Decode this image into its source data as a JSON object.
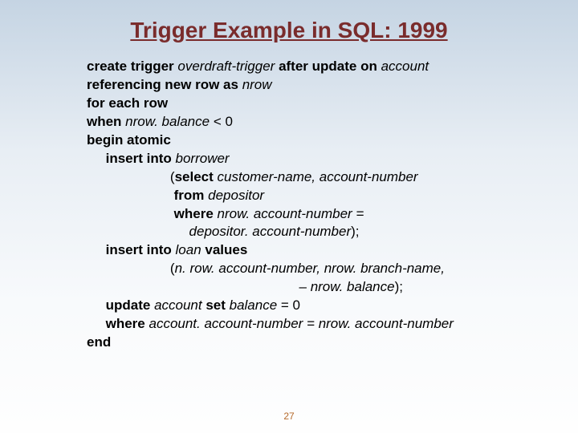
{
  "title": "Trigger Example in SQL: 1999",
  "page_number": "27",
  "code": {
    "l1a": "create trigger ",
    "l1b": "overdraft-trigger ",
    "l1c": "after update on ",
    "l1d": "account",
    "l2a": "referencing new row as ",
    "l2b": "nrow",
    "l3a": "for each row",
    "l4a": "when ",
    "l4b": "nrow. balance ",
    "l4c": "< 0",
    "l5a": "begin atomic",
    "l6a": "     insert into ",
    "l6b": "borrower",
    "l7a": "                      (",
    "l7b": "select ",
    "l7c": "customer-name, account-number",
    "l8a": "                       ",
    "l8b": "from ",
    "l8c": "depositor",
    "l9a": "                       ",
    "l9b": "where ",
    "l9c": "nrow. account-number =",
    "l10a": "                           ",
    "l10b": "depositor. account-number",
    "l10c": ");",
    "l11a": "     insert into ",
    "l11b": "loan ",
    "l11c": "values",
    "l12a": "                      (",
    "l12b": "n. row. account-number, nrow. branch-name,",
    "l13a": "                                                        – ",
    "l13b": "nrow. balance",
    "l13c": ");",
    "l14a": "     update ",
    "l14b": "account ",
    "l14c": "set ",
    "l14d": "balance ",
    "l14e": "= 0",
    "l15a": "     where ",
    "l15b": "account. account-number = nrow. account-number",
    "l16a": "end"
  }
}
